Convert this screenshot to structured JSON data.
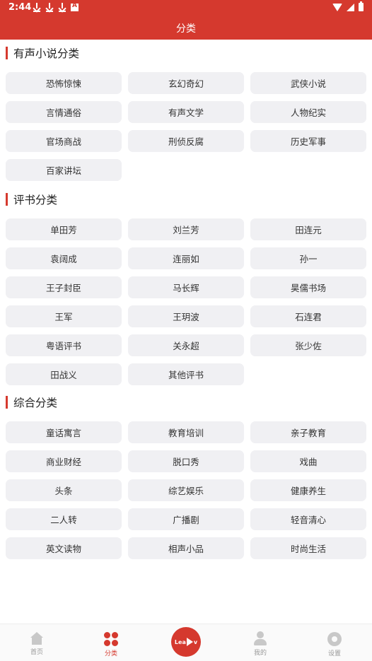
{
  "status": {
    "time": "2:44"
  },
  "header": {
    "title": "分类"
  },
  "sections": [
    {
      "title": "有声小说分类",
      "items": [
        "恐怖惊悚",
        "玄幻奇幻",
        "武侠小说",
        "言情通俗",
        "有声文学",
        "人物纪实",
        "官场商战",
        "刑侦反腐",
        "历史军事",
        "百家讲坛"
      ]
    },
    {
      "title": "评书分类",
      "items": [
        "单田芳",
        "刘兰芳",
        "田连元",
        "袁阔成",
        "连丽如",
        "孙一",
        "王子封臣",
        "马长辉",
        "昊儒书场",
        "王军",
        "王玥波",
        "石连君",
        "粤语评书",
        "关永超",
        "张少佐",
        "田战义",
        "其他评书"
      ]
    },
    {
      "title": "综合分类",
      "items": [
        "童话寓言",
        "教育培训",
        "亲子教育",
        "商业财经",
        "脱口秀",
        "戏曲",
        "头条",
        "综艺娱乐",
        "健康养生",
        "二人转",
        "广播剧",
        "轻音清心",
        "英文读物",
        "相声小品",
        "时尚生活"
      ]
    }
  ],
  "bottom_nav": {
    "home": "首页",
    "category": "分类",
    "center_logo": "Lea",
    "center_logo_suffix": "v",
    "mine": "我的",
    "settings": "设置"
  },
  "colors": {
    "accent": "#d5392e",
    "chip_bg": "#f0f0f3"
  }
}
